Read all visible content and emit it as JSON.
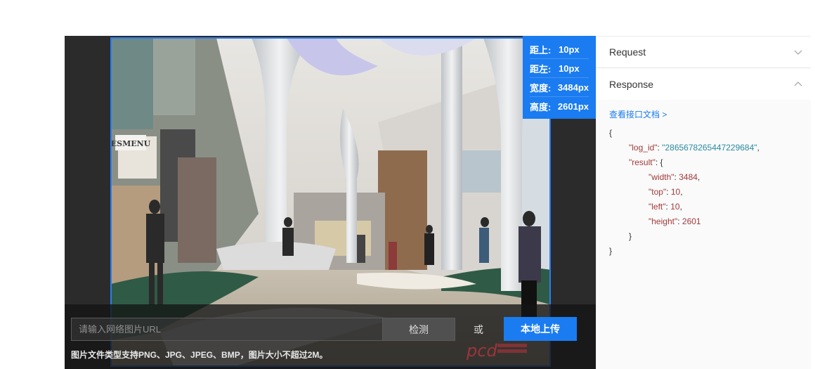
{
  "info": {
    "rows": [
      {
        "key": "距上:",
        "value": "10px"
      },
      {
        "key": "距左:",
        "value": "10px"
      },
      {
        "key": "宽度:",
        "value": "3484px"
      },
      {
        "key": "高度:",
        "value": "2601px"
      }
    ]
  },
  "controls": {
    "url_placeholder": "请输入网络图片URL",
    "detect_label": "检测",
    "or_label": "或",
    "upload_label": "本地上传",
    "hint": "图片文件类型支持PNG、JPG、JPEG、BMP，图片大小不超过2M。"
  },
  "panel": {
    "request_label": "Request",
    "response_label": "Response",
    "doc_link": "查看接口文档 >",
    "json": {
      "open": "{",
      "log_id_key": "\"log_id\"",
      "log_id_value": "\"2865678265447229684\"",
      "result_key": "\"result\"",
      "width_key": "\"width\"",
      "width_value": "3484",
      "top_key": "\"top\"",
      "top_value": "10",
      "left_key": "\"left\"",
      "left_value": "10",
      "height_key": "\"height\"",
      "height_value": "2601",
      "inner_close": "}",
      "close": "}"
    }
  },
  "colors": {
    "accent": "#1a7cf0",
    "panel_bg": "#fafafa",
    "demo_bg": "#2b2b2b"
  },
  "icons": {
    "request_toggle": "chevron-down-icon",
    "response_toggle": "chevron-up-icon"
  }
}
